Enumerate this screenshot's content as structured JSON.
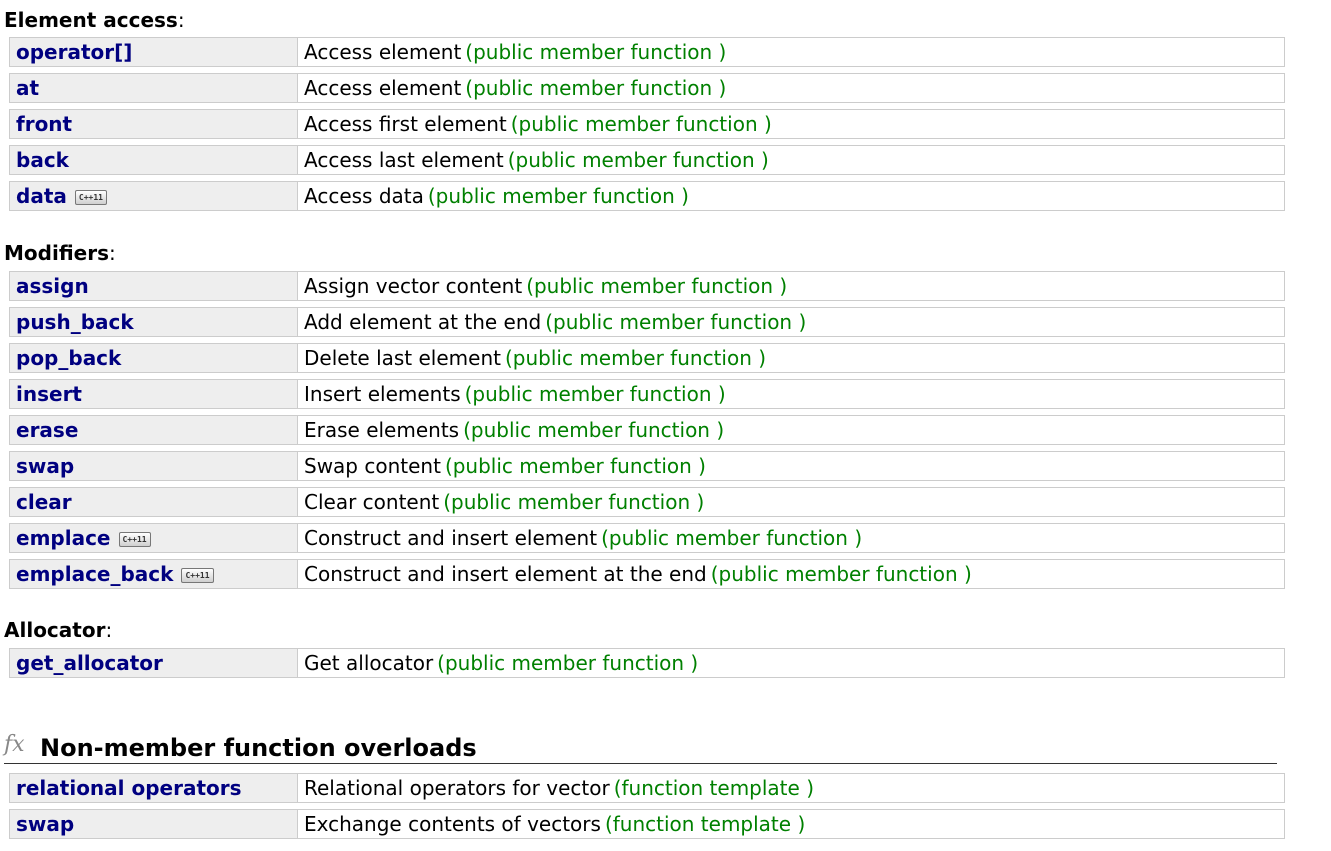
{
  "sections": [
    {
      "title": "Element access",
      "colon": ":",
      "rows": [
        {
          "name": "operator[]",
          "desc": "Access element",
          "kind": "(public member function )"
        },
        {
          "name": "at",
          "desc": "Access element",
          "kind": "(public member function )"
        },
        {
          "name": "front",
          "desc": "Access first element",
          "kind": "(public member function )"
        },
        {
          "name": "back",
          "desc": "Access last element",
          "kind": "(public member function )"
        },
        {
          "name": "data",
          "badge": "C++11",
          "desc": "Access data",
          "kind": "(public member function )"
        }
      ]
    },
    {
      "title": "Modifiers",
      "colon": ":",
      "rows": [
        {
          "name": "assign",
          "desc": "Assign vector content",
          "kind": "(public member function )"
        },
        {
          "name": "push_back",
          "desc": "Add element at the end",
          "kind": "(public member function )"
        },
        {
          "name": "pop_back",
          "desc": "Delete last element",
          "kind": "(public member function )"
        },
        {
          "name": "insert",
          "desc": "Insert elements",
          "kind": "(public member function )"
        },
        {
          "name": "erase",
          "desc": "Erase elements",
          "kind": "(public member function )"
        },
        {
          "name": "swap",
          "desc": "Swap content",
          "kind": "(public member function )"
        },
        {
          "name": "clear",
          "desc": "Clear content",
          "kind": "(public member function )"
        },
        {
          "name": "emplace",
          "badge": "C++11",
          "desc": "Construct and insert element",
          "kind": "(public member function )"
        },
        {
          "name": "emplace_back",
          "badge": "C++11",
          "desc": "Construct and insert element at the end",
          "kind": "(public member function )"
        }
      ]
    },
    {
      "title": "Allocator",
      "colon": ":",
      "rows": [
        {
          "name": "get_allocator",
          "desc": "Get allocator",
          "kind": "(public member function )"
        }
      ]
    }
  ],
  "nonmember": {
    "icon_text": "fx",
    "icon": "fx-icon",
    "heading": "Non-member function overloads",
    "rows": [
      {
        "name": "relational operators",
        "desc": "Relational operators for vector",
        "kind": "(function template )"
      },
      {
        "name": "swap",
        "desc": "Exchange contents of vectors",
        "kind": "(function template )"
      }
    ]
  },
  "colors": {
    "name_link": "#000080",
    "kind_text": "#008000",
    "name_cell_bg": "#eeeeee",
    "border": "#cccccc"
  }
}
